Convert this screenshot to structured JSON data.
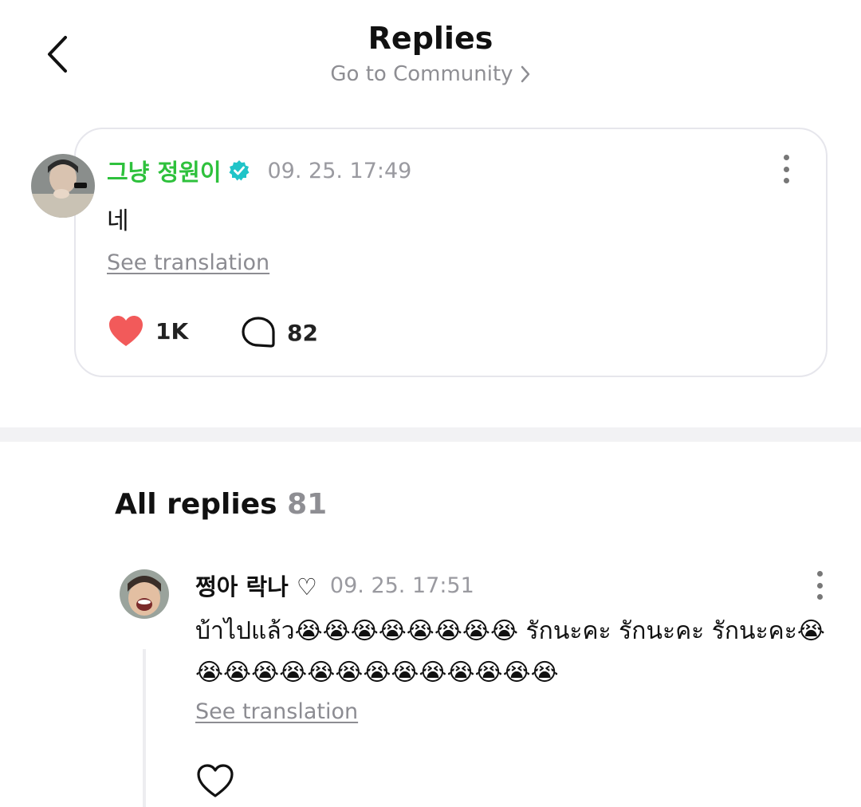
{
  "header": {
    "title": "Replies",
    "community_link": "Go to Community"
  },
  "post": {
    "author": "그냥 정원이",
    "verified": true,
    "timestamp": "09. 25. 17:49",
    "body": "네",
    "translate_label": "See translation",
    "likes": "1K",
    "comments": "82"
  },
  "replies": {
    "heading": "All replies",
    "count": "81",
    "items": [
      {
        "author": "쩡아 락나 ♡",
        "timestamp": "09. 25. 17:51",
        "body": "บ้าไปแล้ว😭😭😭😭😭😭😭😭 รักนะคะ รักนะคะ รักนะคะ😭😭😭😭😭😭😭😭😭😭😭😭😭😭",
        "translate_label": "See translation"
      }
    ]
  },
  "colors": {
    "author_green": "#2ec13c",
    "verified_teal": "#20c4c8",
    "like_red": "#f25a5a",
    "muted_gray": "#8e8e93"
  },
  "icons": [
    "back-arrow-icon",
    "chevron-right-icon",
    "verified-badge-icon",
    "more-vertical-icon",
    "heart-filled-icon",
    "comment-bubble-icon",
    "heart-outline-icon"
  ]
}
